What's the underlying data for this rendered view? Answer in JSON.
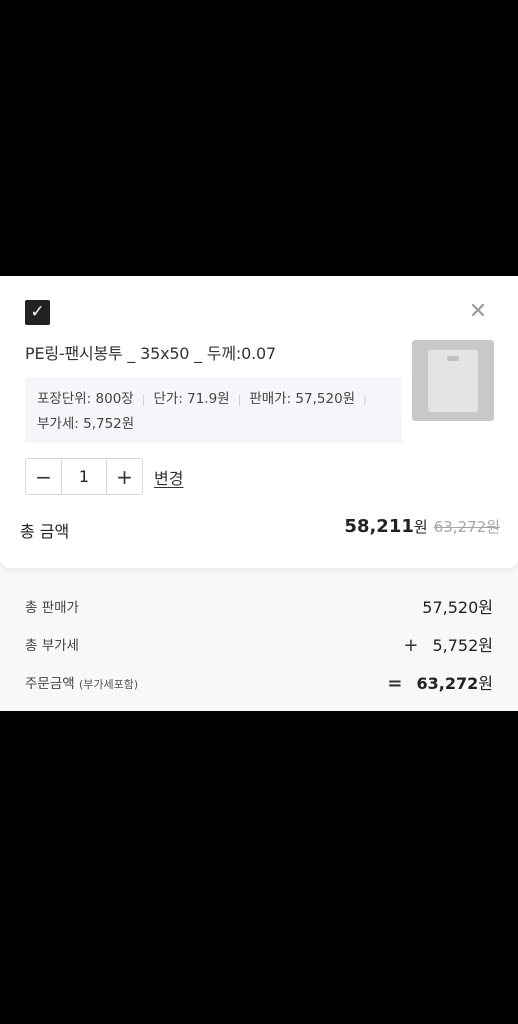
{
  "product": {
    "checked": true,
    "checkbox_glyph": "✓",
    "close_glyph": "✕",
    "name": "PE링-팬시봉투 _ 35x50 _ 두께:0.07",
    "thumbnail_icon": "bag-photo",
    "info": {
      "unit": "포장단위: 800장",
      "unit_price": "단가: 71.9원",
      "sale_price": "판매가: 57,520원",
      "vat": "부가세: 5,752원"
    },
    "stepper": {
      "minus": "−",
      "quantity": "1",
      "plus": "+"
    },
    "change_label": "변경",
    "total_label": "총 금액",
    "total_price": "58,211",
    "total_won": "원",
    "original_price": "63,272원"
  },
  "summary": {
    "sale_label": "총 판매가",
    "sale_value": "57,520원",
    "vat_label": "총 부가세",
    "vat_op": "+",
    "vat_value": "5,752원",
    "order_label": "주문금액",
    "order_sub": "(부가세포함)",
    "order_op": "=",
    "order_value": "63,272",
    "order_won": "원"
  }
}
